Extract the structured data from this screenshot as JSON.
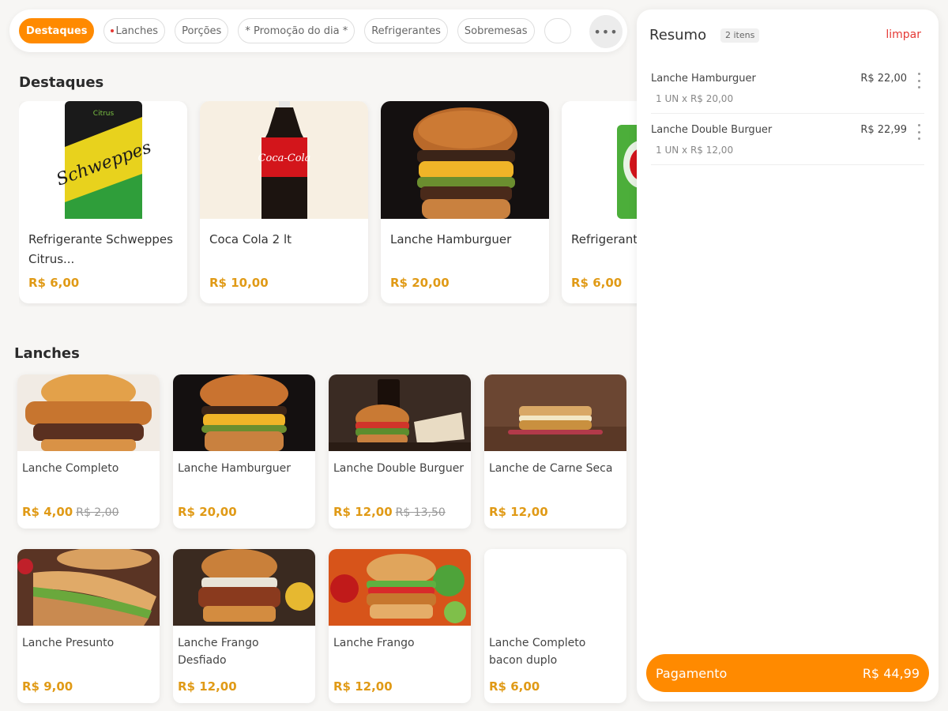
{
  "categories": [
    {
      "label": "Destaques",
      "active": true
    },
    {
      "label": "Lanches",
      "active": false
    },
    {
      "label": "Porções",
      "active": false
    },
    {
      "label": "* Promoção do dia *",
      "active": false
    },
    {
      "label": "Refrigerantes",
      "active": false
    },
    {
      "label": "Sobremesas",
      "active": false
    }
  ],
  "more_button_label": "•••",
  "sections": {
    "destaques_title": "Destaques",
    "lanches_title": "Lanches"
  },
  "destaques": [
    {
      "name": "Refrigerante Schweppes Citrus...",
      "price": "R$ 6,00",
      "image": "schweppes-can"
    },
    {
      "name": "Coca Cola 2 lt",
      "price": "R$ 10,00",
      "image": "coca-cola-bottle"
    },
    {
      "name": "Lanche Hamburguer",
      "price": "R$ 20,00",
      "image": "burger-pulled"
    },
    {
      "name": "Refrigerante Antartica",
      "price": "R$ 6,00",
      "image": "guarana-can"
    }
  ],
  "lanches": [
    {
      "name": "Lanche Completo",
      "price": "R$ 4,00",
      "old_price": "R$ 2,00",
      "image": "burger-completo"
    },
    {
      "name": "Lanche Hamburguer",
      "price": "R$ 20,00",
      "old_price": "",
      "image": "burger-pulled"
    },
    {
      "name": "Lanche Double Burguer",
      "price": "R$ 12,00",
      "old_price": "R$ 13,50",
      "image": "burger-double"
    },
    {
      "name": "Lanche de Carne Seca",
      "price": "R$ 12,00",
      "old_price": "",
      "image": "carne-seca"
    },
    {
      "name": "Lanche Presunto",
      "price": "R$ 9,00",
      "old_price": "",
      "image": "presunto"
    },
    {
      "name": "Lanche Frango Desfiado",
      "price": "R$ 12,00",
      "old_price": "",
      "image": "frango-desfiado"
    },
    {
      "name": "Lanche Frango",
      "price": "R$ 12,00",
      "old_price": "",
      "image": "frango"
    },
    {
      "name": "Lanche Completo bacon duplo",
      "price": "R$ 6,00",
      "old_price": "",
      "image": ""
    }
  ],
  "summary": {
    "title": "Resumo",
    "count_badge": "2 itens",
    "clear_label": "limpar",
    "items": [
      {
        "name": "Lanche Hamburguer",
        "price": "R$ 22,00",
        "detail": "1 UN   x R$ 20,00"
      },
      {
        "name": "Lanche Double Burguer",
        "price": "R$ 22,99",
        "detail": "1 UN   x R$ 12,00"
      }
    ],
    "pay_label": "Pagamento",
    "total": "R$ 44,99"
  },
  "colors": {
    "accent": "#ff8a00",
    "price": "#e09a16",
    "danger": "#e53935"
  }
}
